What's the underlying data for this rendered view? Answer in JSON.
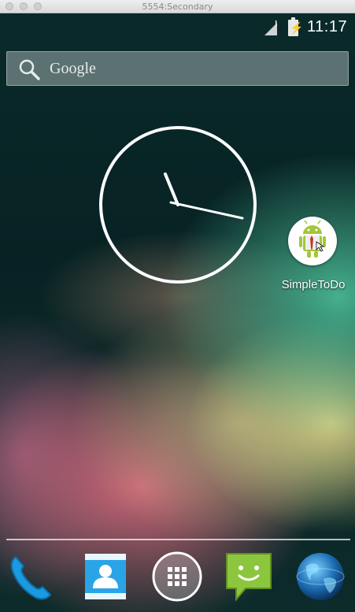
{
  "window": {
    "title": "5554:Secondary"
  },
  "status_bar": {
    "time": "11:17",
    "signal_icon": "signal-no-service-icon",
    "battery_icon": "battery-charging-icon"
  },
  "search": {
    "label": "Google",
    "icon": "search-icon"
  },
  "clock_widget": {
    "type": "analog",
    "hour_hand_time": "11:17"
  },
  "desktop_apps": [
    {
      "label": "SimpleToDo",
      "icon": "android-robot-icon"
    }
  ],
  "dock": [
    {
      "icon": "phone-icon"
    },
    {
      "icon": "contacts-icon"
    },
    {
      "icon": "app-drawer-icon"
    },
    {
      "icon": "messaging-icon"
    },
    {
      "icon": "browser-globe-icon"
    }
  ],
  "colors": {
    "android_green": "#a4c639",
    "phone_blue": "#1a9ae0"
  }
}
